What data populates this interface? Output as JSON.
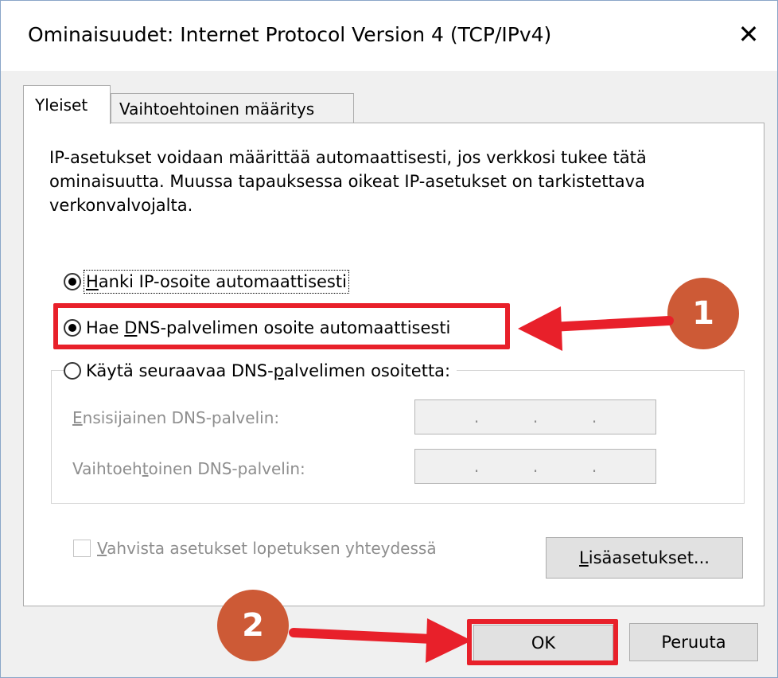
{
  "window": {
    "title": "Ominaisuudet: Internet Protocol Version 4 (TCP/IPv4)",
    "close_glyph": "✕"
  },
  "tabs": [
    {
      "label": "Yleiset",
      "selected": true
    },
    {
      "label": "Vaihtoehtoinen määritys",
      "selected": false
    }
  ],
  "intro_text": "IP-asetukset voidaan määrittää automaattisesti, jos verkkosi tukee tätä ominaisuutta. Muussa tapauksessa oikeat IP-asetukset on tarkistettava verkonvalvojalta.",
  "radios": {
    "ip_auto": {
      "before": "",
      "mn": "H",
      "after": "anki IP-osoite automaattisesti",
      "selected": true
    },
    "dns_auto": {
      "before": "Hae ",
      "mn": "D",
      "after": "NS-palvelimen osoite automaattisesti",
      "selected": true
    },
    "dns_manual": {
      "before": "Käytä seuraavaa DNS-",
      "mn": "p",
      "after": "alvelimen osoitetta:",
      "selected": false
    }
  },
  "dns_fields": {
    "preferred": {
      "mn": "E",
      "after": "nsisijainen DNS-palvelin:",
      "dots": [
        ".",
        ".",
        "."
      ]
    },
    "alternate": {
      "before": "Vaihtoeh",
      "mn": "t",
      "after": "oinen DNS-palvelin:",
      "dots": [
        ".",
        ".",
        "."
      ]
    }
  },
  "validate_checkbox": {
    "mn": "V",
    "after": "ahvista asetukset lopetuksen yhteydessä",
    "checked": false
  },
  "buttons": {
    "advanced": {
      "mn": "L",
      "after": "isäasetukset..."
    },
    "ok": "OK",
    "cancel": "Peruuta"
  },
  "annotations": {
    "step1": "1",
    "step2": "2",
    "color": "#e8202a",
    "badge_color": "#cd5a36"
  }
}
